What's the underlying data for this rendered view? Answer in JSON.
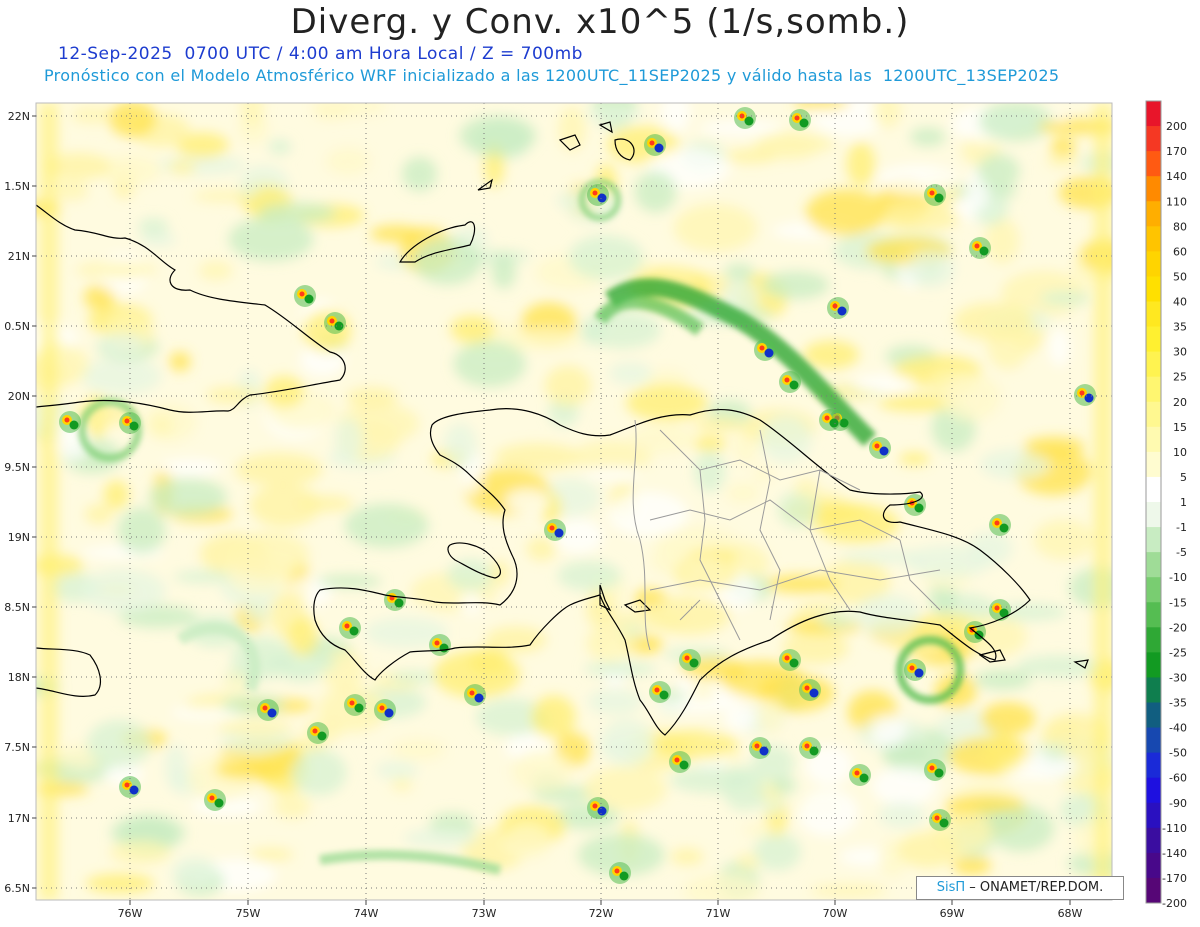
{
  "header": {
    "title": "Diverg. y Conv. x10^5 (1/s,somb.)",
    "subtitle1": "12-Sep-2025  0700 UTC / 4:00 am Hora Local / Z = 700mb",
    "subtitle2": "Pronóstico con el Modelo Atmosférico WRF inicializado a las 1200UTC_11SEP2025 y válido hasta las  1200UTC_13SEP2025"
  },
  "map": {
    "lat_ticks": [
      "22N",
      "1.5N",
      "21N",
      "0.5N",
      "20N",
      "9.5N",
      "19N",
      "8.5N",
      "18N",
      "7.5N",
      "17N",
      "6.5N"
    ],
    "lon_ticks": [
      "76W",
      "75W",
      "74W",
      "73W",
      "72W",
      "71W",
      "70W",
      "69W",
      "68W"
    ],
    "region": "Hispaniola / Cuba oriental / Bahamas",
    "colors": {
      "positive_weak": "#fffbc0",
      "positive_mid": "#ffe14a",
      "positive_strong": "#ff3a1a",
      "negative_weak": "#d7f2d2",
      "negative_mid": "#3cb34a",
      "negative_strong": "#1030c8",
      "coastline": "#000000",
      "borders": "#9a9a9a"
    }
  },
  "colorbar": {
    "labels": [
      "200",
      "170",
      "140",
      "110",
      "80",
      "60",
      "50",
      "40",
      "35",
      "30",
      "25",
      "20",
      "15",
      "10",
      "5",
      "1",
      "-1",
      "-5",
      "-10",
      "-15",
      "-20",
      "-25",
      "-30",
      "-35",
      "-40",
      "-50",
      "-60",
      "-90",
      "-110",
      "-140",
      "-170",
      "-200"
    ],
    "colors": [
      "#e8152a",
      "#f53823",
      "#ff5a12",
      "#ff8a00",
      "#ffae00",
      "#ffc400",
      "#ffd400",
      "#ffe000",
      "#ffe820",
      "#fff030",
      "#fff350",
      "#fff670",
      "#fff890",
      "#fffab0",
      "#fffcd0",
      "#ffffff",
      "#eef8ea",
      "#c8ecc2",
      "#9fdc97",
      "#79cd71",
      "#55bd52",
      "#2fa835",
      "#129a22",
      "#0f7e4e",
      "#115e80",
      "#1748b0",
      "#1a2ad8",
      "#1e10e0",
      "#2a10c0",
      "#3a0da0",
      "#48088a",
      "#560676"
    ]
  },
  "credit": {
    "sis": "SisΠ",
    "rest": " – ONAMET/REP.DOM."
  }
}
